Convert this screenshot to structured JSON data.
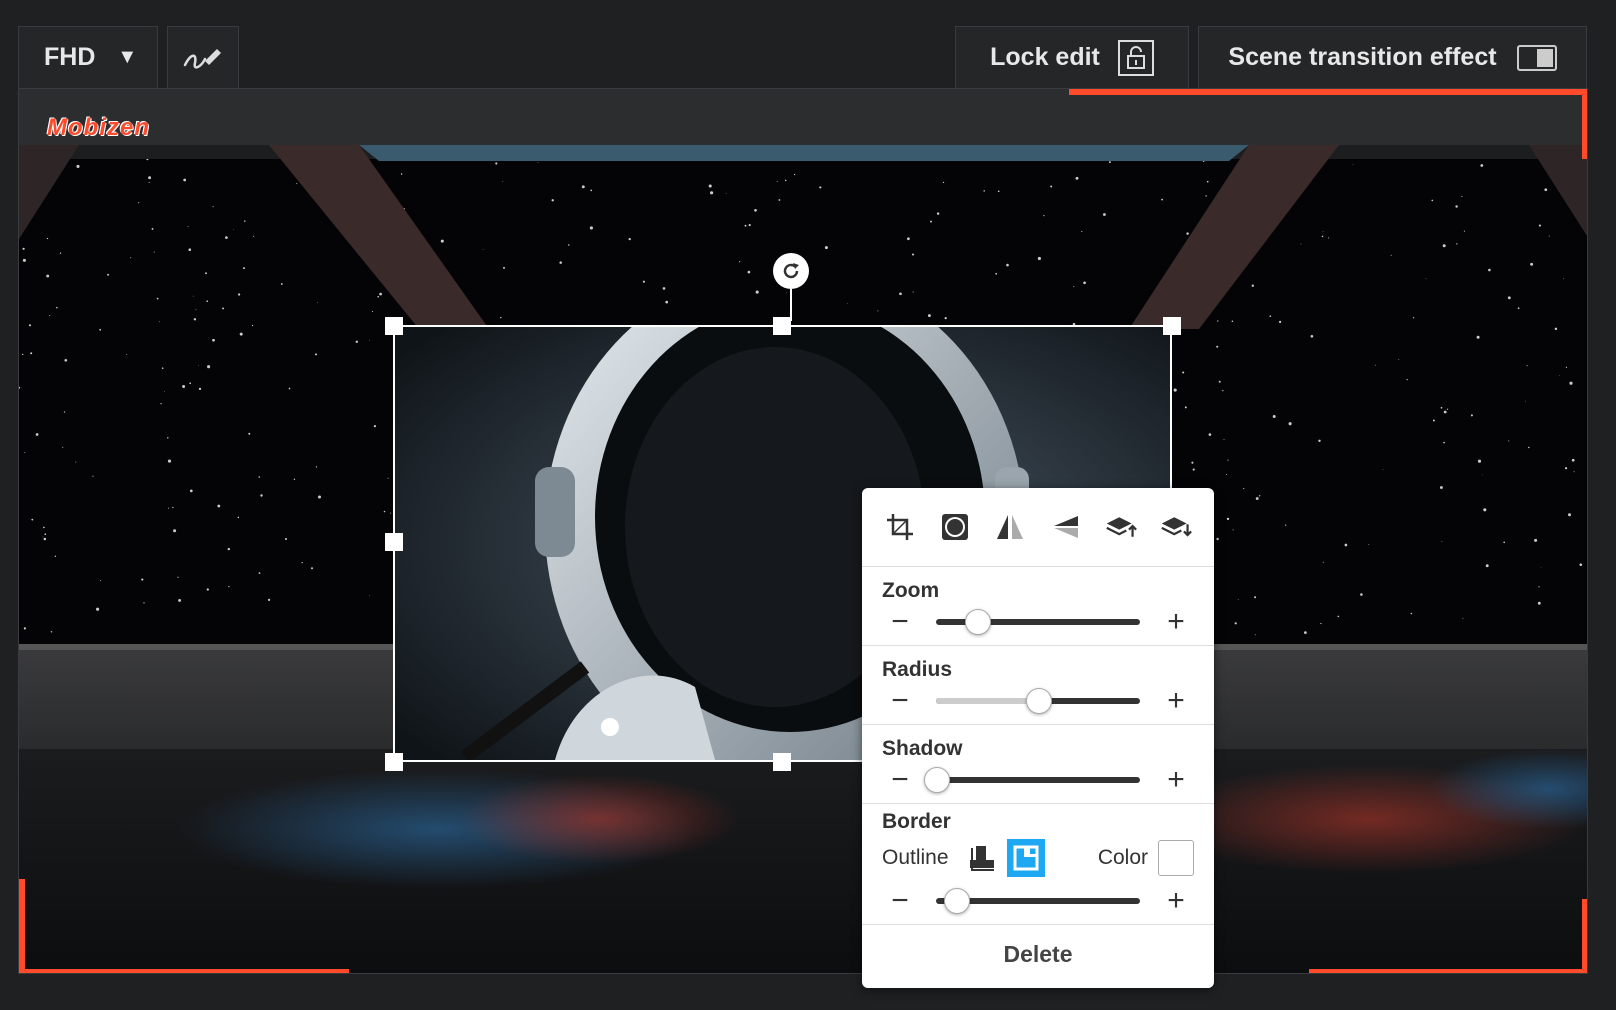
{
  "toolbar": {
    "resolution_label": "FHD",
    "resolution_arrow": "▼",
    "lock_label": "Lock edit",
    "scene_label": "Scene transition effect",
    "scene_toggle_on": false
  },
  "stage": {
    "logo_text": "Mobizen",
    "accent_color": "#ff4a2b"
  },
  "panel": {
    "icons": [
      "crop-icon",
      "circle-mask-icon",
      "flip-horizontal-icon",
      "flip-vertical-icon",
      "bring-forward-icon",
      "send-backward-icon"
    ],
    "zoom": {
      "title": "Zoom",
      "value": 0.2
    },
    "radius": {
      "title": "Radius",
      "value": 0.5
    },
    "shadow": {
      "title": "Shadow",
      "value": 0.0
    },
    "border": {
      "title": "Border",
      "outline_label": "Outline",
      "color_label": "Color",
      "color_value": "#ffffff",
      "active_outline": "inner",
      "value": 0.1
    },
    "delete_label": "Delete",
    "minus": "−",
    "plus": "+"
  }
}
